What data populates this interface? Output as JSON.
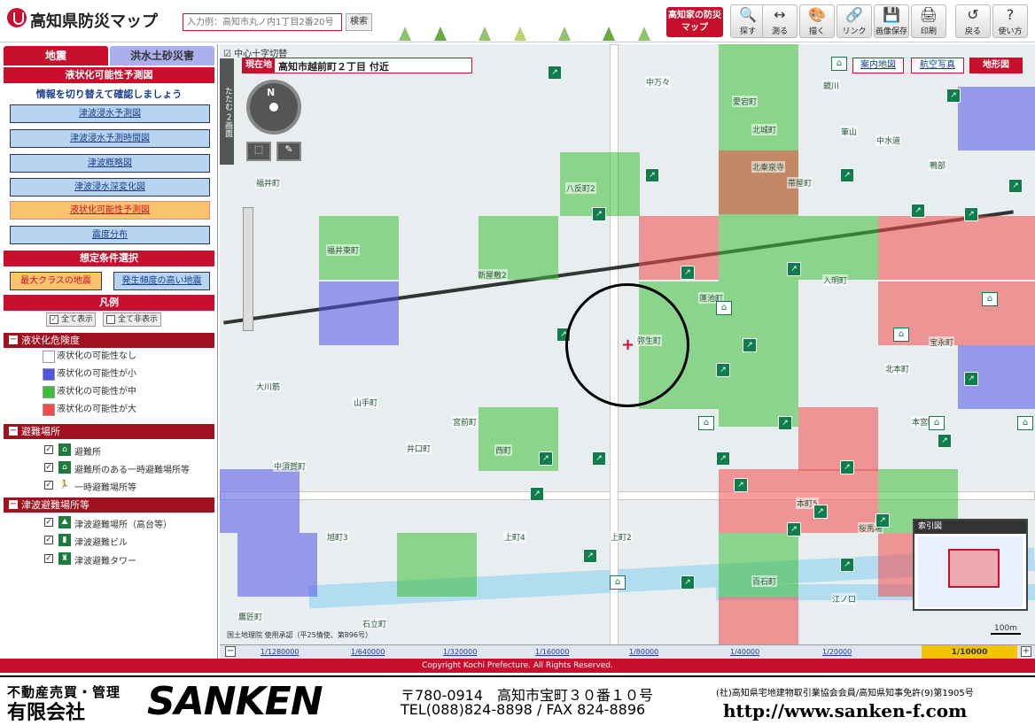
{
  "header": {
    "app_title": "高知県防災マップ",
    "search_placeholder": "入力例：高知市丸ノ内1丁目2番20号",
    "search_button": "検索",
    "kochi_button": "高知家の防災マップ",
    "toolbar": [
      {
        "icon": "magnifier-icon",
        "label": "探す"
      },
      {
        "icon": "ruler-icon",
        "label": "測る"
      },
      {
        "icon": "palette-icon",
        "label": "描く"
      },
      {
        "icon": "link-icon",
        "label": "リンク"
      },
      {
        "icon": "save-image-icon",
        "label": "画像保存"
      },
      {
        "icon": "printer-icon",
        "label": "印刷"
      },
      {
        "icon": "back-icon",
        "label": "戻る"
      },
      {
        "icon": "help-icon",
        "label": "使い方"
      }
    ]
  },
  "sidebar": {
    "tabs": [
      "地震",
      "洪水土砂災害"
    ],
    "section_title": "液状化可能性予測図",
    "switch_note": "情報を切り替えて確認しましょう",
    "menu": [
      "津波浸水予測図",
      "津波浸水予測時間図",
      "津波概略図",
      "津波浸水深変化図",
      "液状化可能性予測図",
      "震度分布"
    ],
    "active_menu": "液状化可能性予測図",
    "condition_title": "想定条件選択",
    "conditions": [
      "最大クラスの地震",
      "発生頻度の高い地震"
    ],
    "legend_title": "凡例",
    "show_all": "全て表示",
    "hide_all": "全て非表示",
    "liquefaction": {
      "title": "液状化危険度",
      "items": [
        {
          "label": "液状化の可能性なし",
          "color": "#ffffff"
        },
        {
          "label": "液状化の可能性が小",
          "color": "#5153e3"
        },
        {
          "label": "液状化の可能性が中",
          "color": "#3cbf38"
        },
        {
          "label": "液状化の可能性が大",
          "color": "#f24b4b"
        }
      ]
    },
    "evacuation": {
      "title": "避難場所",
      "items": [
        "避難所",
        "避難所のある一時避難場所等",
        "一時避難場所等"
      ]
    },
    "tsunami_evac": {
      "title": "津波避難場所等",
      "items": [
        "津波避難場所（高台等）",
        "津波避難ビル",
        "津波避難タワー"
      ]
    }
  },
  "map": {
    "crosshair_toggle": "中心十字切替",
    "current_label": "現在地",
    "current_address": "高知市越前町２丁目 付近",
    "map_types": [
      "案内地図",
      "航空写真",
      "地形図"
    ],
    "active_map_type": "地形図",
    "collapse_label": "たたむ",
    "dual_label": "２画面",
    "compass_letter": "N",
    "index_title": "索引図",
    "scale_label": "100m",
    "credit": "国土地理院 使用承認（平25情使、第896号）",
    "place_names": [
      "福井東町",
      "新屋敷2",
      "八反町2",
      "愛宕町",
      "中水道",
      "福井町",
      "北秦泉寺",
      "中万々",
      "北城町",
      "山手町",
      "宮前町",
      "西町",
      "井口町",
      "中須賀町",
      "旭町3",
      "大川筋",
      "鷹匠町",
      "本町5",
      "上町2",
      "上町4",
      "石立町",
      "鴨部",
      "入明町",
      "弥生町",
      "江ノ口",
      "桜馬場",
      "筆山",
      "宝永町",
      "北本町",
      "本宮町",
      "百石町",
      "蓮池町",
      "帯屋町",
      "鏡川",
      "永国寺町"
    ],
    "zoom_levels": [
      "1/1280000",
      "1/640000",
      "1/320000",
      "1/160000",
      "1/80000",
      "1/40000",
      "1/20000",
      "1/10000"
    ],
    "active_zoom": "1/10000"
  },
  "footer": {
    "copyright": "Copyright Kochi Prefecture. All Rights Reserved."
  },
  "banner": {
    "line1": "不動産売買・管理",
    "line2": "有限会社",
    "brand": "SANKEN",
    "address": "〒780-0914　高知市宝町３０番１０号",
    "tel": "TEL(088)824-8898 / FAX 824-8896",
    "association": "(社)高知県宅地建物取引業協会会員/高知県知事免許(9)第1905号",
    "url": "http://www.sanken-f.com"
  },
  "colors": {
    "accent": "#c8102e",
    "low": "#5153e3",
    "mid": "#3cbf38",
    "high": "#f24b4b",
    "active_zoom": "#f4c400"
  }
}
